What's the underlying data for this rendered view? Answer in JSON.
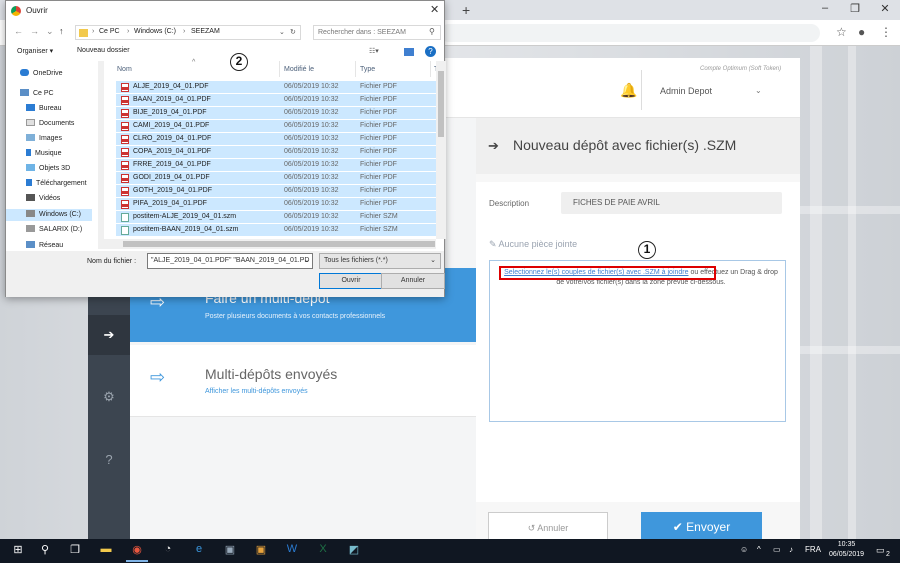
{
  "browser": {
    "new_tab_symbol": "+",
    "window_controls": [
      "–",
      "❐",
      "✕"
    ]
  },
  "app": {
    "account_label": "Compte Optimum (Soft Token)",
    "user_name": "Admin Depot",
    "left_cards": [
      {
        "title": "Faire un multi-dépot",
        "subtitle": "Poster plusieurs documents à vos contacts professionnels"
      },
      {
        "title": "Multi-dépôts envoyés",
        "subtitle": "Afficher les multi-dépôts envoyés"
      }
    ],
    "panel_title": "Nouveau dépôt avec fichier(s) .SZM",
    "description_label": "Description",
    "description_value": "FICHES DE PAIE AVRIL",
    "no_attachment": "Aucune pièce jointe",
    "dropzone_link": "Selectionnez le(s) couples de fichier(s) avec .SZM à joindre",
    "dropzone_text": " ou effectuez un Drag & drop de votre/vos fichier(s) dans la zone prévue ci-dessous.",
    "cancel_label": "Annuler",
    "send_label": "Envoyer",
    "accent_color": "#3f97dc"
  },
  "callouts": [
    "1",
    "2"
  ],
  "dialog": {
    "title": "Ouvrir",
    "path": [
      "Ce PC",
      "Windows (C:)",
      "SEEZAM"
    ],
    "search_placeholder": "Rechercher dans : SEEZAM",
    "organize_label": "Organiser ▾",
    "new_folder_label": "Nouveau dossier",
    "nav_items": [
      "OneDrive",
      "Ce PC",
      "Bureau",
      "Documents",
      "Images",
      "Musique",
      "Objets 3D",
      "Téléchargement",
      "Vidéos",
      "Windows (C:)",
      "SALARIX (D:)",
      "Réseau"
    ],
    "columns": [
      "Nom",
      "Modifié le",
      "Type",
      "Ta"
    ],
    "files": [
      {
        "name": "ALJE_2019_04_01.PDF",
        "date": "06/05/2019 10:32",
        "type": "Fichier PDF",
        "kind": "pdf"
      },
      {
        "name": "BAAN_2019_04_01.PDF",
        "date": "06/05/2019 10:32",
        "type": "Fichier PDF",
        "kind": "pdf"
      },
      {
        "name": "BIJE_2019_04_01.PDF",
        "date": "06/05/2019 10:32",
        "type": "Fichier PDF",
        "kind": "pdf"
      },
      {
        "name": "CAMI_2019_04_01.PDF",
        "date": "06/05/2019 10:32",
        "type": "Fichier PDF",
        "kind": "pdf"
      },
      {
        "name": "CLRO_2019_04_01.PDF",
        "date": "06/05/2019 10:32",
        "type": "Fichier PDF",
        "kind": "pdf"
      },
      {
        "name": "COPA_2019_04_01.PDF",
        "date": "06/05/2019 10:32",
        "type": "Fichier PDF",
        "kind": "pdf"
      },
      {
        "name": "FRRE_2019_04_01.PDF",
        "date": "06/05/2019 10:32",
        "type": "Fichier PDF",
        "kind": "pdf"
      },
      {
        "name": "GODI_2019_04_01.PDF",
        "date": "06/05/2019 10:32",
        "type": "Fichier PDF",
        "kind": "pdf"
      },
      {
        "name": "GOTH_2019_04_01.PDF",
        "date": "06/05/2019 10:32",
        "type": "Fichier PDF",
        "kind": "pdf"
      },
      {
        "name": "PIFA_2019_04_01.PDF",
        "date": "06/05/2019 10:32",
        "type": "Fichier PDF",
        "kind": "pdf"
      },
      {
        "name": "postitem-ALJE_2019_04_01.szm",
        "date": "06/05/2019 10:32",
        "type": "Fichier SZM",
        "kind": "szm"
      },
      {
        "name": "postitem-BAAN_2019_04_01.szm",
        "date": "06/05/2019 10:32",
        "type": "Fichier SZM",
        "kind": "szm"
      }
    ],
    "filename_label": "Nom du fichier :",
    "filename_value": "\"ALJE_2019_04_01.PDF\" \"BAAN_2019_04_01.PD",
    "filter_value": "Tous les fichiers (*.*)",
    "open_label": "Ouvrir",
    "cancel_label": "Annuler"
  },
  "taskbar": {
    "language": "FRA",
    "time": "10:35",
    "date": "06/05/2019",
    "notifications": "2"
  }
}
